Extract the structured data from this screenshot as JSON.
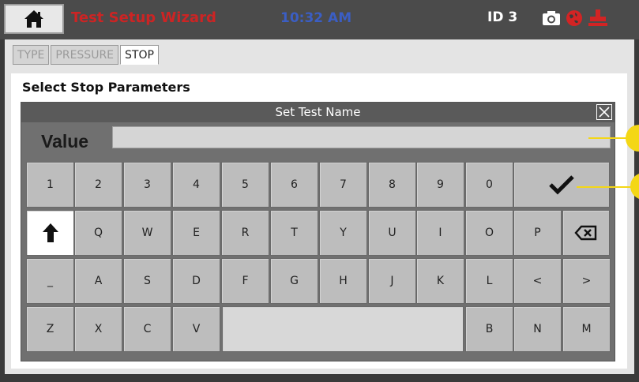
{
  "header": {
    "title": "Test Setup Wizard",
    "clock": "10:32 AM",
    "device_id": "ID 3"
  },
  "icons": {
    "home": "home-icon",
    "camera": "camera-icon",
    "globe": "globe-icon",
    "connector": "connector-icon"
  },
  "tabs": [
    {
      "label": "TYPE"
    },
    {
      "label": "PRESSURE"
    },
    {
      "label": "STOP"
    }
  ],
  "heading": "Select Stop Parameters",
  "dialog": {
    "title": "Set Test Name",
    "value_label": "Value",
    "value": "",
    "keys": {
      "row1": [
        "1",
        "2",
        "3",
        "4",
        "5",
        "6",
        "7",
        "8",
        "9",
        "0"
      ],
      "row2": [
        "Q",
        "W",
        "E",
        "R",
        "T",
        "Y",
        "U",
        "I",
        "O",
        "P"
      ],
      "row3": [
        "_",
        "A",
        "S",
        "D",
        "F",
        "G",
        "H",
        "J",
        "K",
        "L",
        "<",
        ">"
      ],
      "row4a": [
        "Z",
        "X",
        "C",
        "V"
      ],
      "row4b": [
        "B",
        "N",
        "M"
      ]
    }
  },
  "colors": {
    "title": "#cc2424",
    "clock": "#3b5ec4",
    "callout": "#f4d716"
  }
}
